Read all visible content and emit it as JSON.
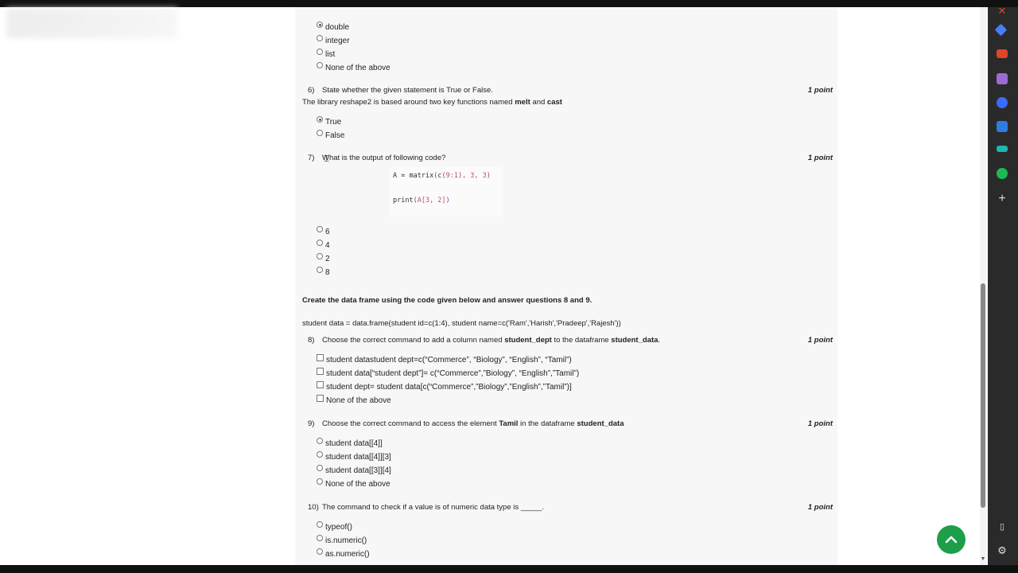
{
  "q5": {
    "options": [
      "double",
      "integer",
      "list",
      "None of the above"
    ],
    "selected": 0
  },
  "q6": {
    "number": "6)",
    "text": "State whether the given statement is True or False.",
    "points": "1 point",
    "statement_prefix": "The library reshape2 is based around two key functions named ",
    "statement_bold1": "melt",
    "statement_and": " and ",
    "statement_bold2": "cast",
    "options": [
      "True",
      "False"
    ],
    "selected": 0
  },
  "q7": {
    "number": "7)",
    "text": "What is the output of following code?",
    "points": "1 point",
    "code": {
      "line1": {
        "var": "A = ",
        "fn": "matrix",
        "open": "(",
        "fn2": "c",
        "open2": "(",
        "range": "9:1",
        "close2": ")",
        "rest": ", 3, 3",
        "close": ")"
      },
      "line2": {
        "fn": "print",
        "open": "(",
        "arg": "A[3, 2]",
        "close": ")"
      }
    },
    "options": [
      "6",
      "4",
      "2",
      "8"
    ]
  },
  "section": {
    "instruction": "Create the data frame using the code given below and answer questions 8 and 9.",
    "code_line": "student data = data.frame(student id=c(1:4), student name=c('Ram','Harish','Pradeep','Rajesh'))"
  },
  "q8": {
    "number": "8)",
    "text_prefix": "Choose the correct command to add a column named ",
    "text_bold1": "student_dept",
    "text_mid": " to the dataframe ",
    "text_bold2": "student_data",
    "text_suffix": ".",
    "points": "1 point",
    "options": [
      "student datastudent dept=c(“Commerce”, “Biology”, “English”, “Tamil”)",
      "student data[“student dept”]= c(“Commerce”,”Biology”, “English”,”Tamil”)",
      "student dept= student data[c(“Commerce”,”Biology”,”English”,”Tamil”)]",
      "None of the above"
    ]
  },
  "q9": {
    "number": "9)",
    "text_prefix": "Choose the correct command to access the element ",
    "text_bold1": "Tamil",
    "text_mid": " in the dataframe ",
    "text_bold2": "student_data",
    "points": "1 point",
    "options": [
      "student data[[4]]",
      "student data[[4]][3]",
      "student data[[3]][4]",
      "None of the above"
    ]
  },
  "q10": {
    "number": "10)",
    "text": "The command to check if a value is of numeric data type is _____.",
    "points": "1 point",
    "options": [
      "typeof()",
      "is.numeric()",
      "as.numeric()"
    ]
  },
  "colors": {
    "fab": "#1e9e4a",
    "sidebar": "#2a2a2a",
    "sidebar_icons": [
      "#4a7cff",
      "#e0452b",
      "#9b6bd1",
      "#3a6bff",
      "#2f7be0",
      "#1fb5b0",
      "#1db954"
    ]
  },
  "icons": {
    "sidebar": [
      "close-icon",
      "tag-icon",
      "briefcase-icon",
      "person-icon",
      "games-icon",
      "outlook-icon",
      "tool-icon",
      "spotify-icon",
      "add-icon",
      "sidebar-panel-icon",
      "settings-icon"
    ],
    "fab": "chevron-up-icon"
  }
}
